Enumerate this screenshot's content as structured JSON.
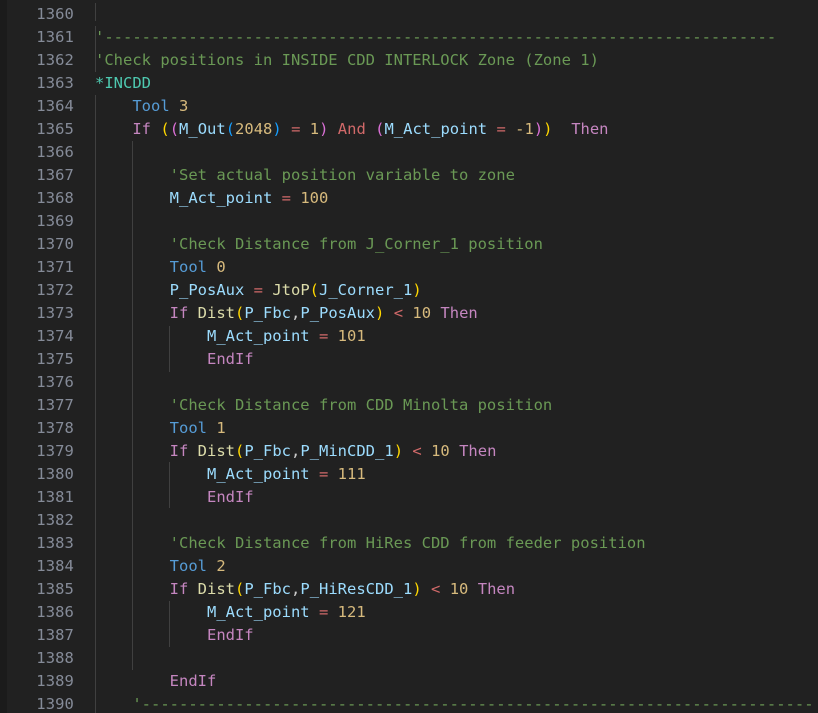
{
  "editor": {
    "theme": "dark-plus",
    "language": "robot-basic",
    "background_color": "#212121",
    "gutter_color": "#1b1b1b",
    "line_number_color": "#858b98",
    "indent_guide_color": "#404040",
    "font_size_px": 15.5,
    "line_height_px": 23,
    "first_line_number": 1360,
    "last_line_number": 1390,
    "total_visible_lines": 31
  },
  "syntax_colors": {
    "comment": "#6A9955",
    "label": "#4EC9B0",
    "keyword": "#C586C0",
    "tool_keyword": "#569CD6",
    "variable": "#9CDCFE",
    "number": "#D7BA7D",
    "operator": "#D16969",
    "function": "#DCDCAA",
    "bracket_level_1": "#FFD700",
    "bracket_level_2": "#DA70D6",
    "bracket_level_3": "#179FFF"
  },
  "lines": [
    {
      "number": "1360",
      "text": ""
    },
    {
      "number": "1361",
      "text": "    '------------------------------------------------------------------------"
    },
    {
      "number": "1362",
      "text": "'Check positions in INSIDE CDD INTERLOCK Zone (Zone 1)"
    },
    {
      "number": "1363",
      "text": "*INCDD"
    },
    {
      "number": "1364",
      "text": "    Tool 3"
    },
    {
      "number": "1365",
      "text": "    If ((M_Out(2048) = 1) And (M_Act_point = -1))  Then"
    },
    {
      "number": "1366",
      "text": ""
    },
    {
      "number": "1367",
      "text": "        'Set actual position variable to zone"
    },
    {
      "number": "1368",
      "text": "        M_Act_point = 100"
    },
    {
      "number": "1369",
      "text": ""
    },
    {
      "number": "1370",
      "text": "        'Check Distance from J_Corner_1 position"
    },
    {
      "number": "1371",
      "text": "        Tool 0"
    },
    {
      "number": "1372",
      "text": "        P_PosAux = JtoP(J_Corner_1)"
    },
    {
      "number": "1373",
      "text": "        If Dist(P_Fbc,P_PosAux) < 10 Then"
    },
    {
      "number": "1374",
      "text": "            M_Act_point = 101"
    },
    {
      "number": "1375",
      "text": "            EndIf"
    },
    {
      "number": "1376",
      "text": ""
    },
    {
      "number": "1377",
      "text": "        'Check Distance from CDD Minolta position"
    },
    {
      "number": "1378",
      "text": "        Tool 1"
    },
    {
      "number": "1379",
      "text": "        If Dist(P_Fbc,P_MinCDD_1) < 10 Then"
    },
    {
      "number": "1380",
      "text": "            M_Act_point = 111"
    },
    {
      "number": "1381",
      "text": "            EndIf"
    },
    {
      "number": "1382",
      "text": ""
    },
    {
      "number": "1383",
      "text": "        'Check Distance from HiRes CDD from feeder position"
    },
    {
      "number": "1384",
      "text": "        Tool 2"
    },
    {
      "number": "1385",
      "text": "        If Dist(P_Fbc,P_HiResCDD_1) < 10 Then"
    },
    {
      "number": "1386",
      "text": "            M_Act_point = 121"
    },
    {
      "number": "1387",
      "text": "            EndIf"
    },
    {
      "number": "1388",
      "text": ""
    },
    {
      "number": "1389",
      "text": "        EndIf"
    },
    {
      "number": "1390",
      "text": "    '------------------------------------------------------------------------"
    }
  ],
  "line_numbers": [
    "1360",
    "1361",
    "1362",
    "1363",
    "1364",
    "1365",
    "1366",
    "1367",
    "1368",
    "1369",
    "1370",
    "1371",
    "1372",
    "1373",
    "1374",
    "1375",
    "1376",
    "1377",
    "1378",
    "1379",
    "1380",
    "1381",
    "1382",
    "1383",
    "1384",
    "1385",
    "1386",
    "1387",
    "1388",
    "1389",
    "1390"
  ],
  "code_tokens": {
    "l1361": {
      "indent": "    ",
      "comment": "'------------------------------------------------------------------------"
    },
    "l1362": {
      "comment": "'Check positions in INSIDE CDD INTERLOCK Zone (Zone 1)"
    },
    "l1363": {
      "label": "*INCDD"
    },
    "l1364": {
      "indent": "    ",
      "kw": "Tool",
      "num": "3"
    },
    "l1365": {
      "indent": "    ",
      "if": "If",
      "b1_open": "(",
      "b2_open": "(",
      "var1": "M_Out",
      "b3_open": "(",
      "num1": "2048",
      "b3_close": ")",
      "eq1": "=",
      "num2": "1",
      "b2_close": ")",
      "and": "And",
      "b2_open2": "(",
      "var2": "M_Act_point",
      "eq2": "=",
      "num3": "-1",
      "b2_close2": ")",
      "b1_close": ")",
      "then": "Then"
    },
    "l1367": {
      "indent": "        ",
      "comment": "'Set actual position variable to zone"
    },
    "l1368": {
      "indent": "        ",
      "var": "M_Act_point",
      "eq": "=",
      "num": "100"
    },
    "l1370": {
      "indent": "        ",
      "comment": "'Check Distance from J_Corner_1 position"
    },
    "l1371": {
      "indent": "        ",
      "kw": "Tool",
      "num": "0"
    },
    "l1372": {
      "indent": "        ",
      "var1": "P_PosAux",
      "eq": "=",
      "fn": "JtoP",
      "open": "(",
      "var2": "J_Corner_1",
      "close": ")"
    },
    "l1373": {
      "indent": "        ",
      "if": "If",
      "fn": "Dist",
      "open": "(",
      "var1": "P_Fbc",
      "comma": ",",
      "var2": "P_PosAux",
      "close": ")",
      "lt": "<",
      "num": "10",
      "then": "Then"
    },
    "l1374": {
      "indent": "            ",
      "var": "M_Act_point",
      "eq": "=",
      "num": "101"
    },
    "l1375": {
      "indent": "            ",
      "kw": "EndIf"
    },
    "l1377": {
      "indent": "        ",
      "comment": "'Check Distance from CDD Minolta position"
    },
    "l1378": {
      "indent": "        ",
      "kw": "Tool",
      "num": "1"
    },
    "l1379": {
      "indent": "        ",
      "if": "If",
      "fn": "Dist",
      "open": "(",
      "var1": "P_Fbc",
      "comma": ",",
      "var2": "P_MinCDD_1",
      "close": ")",
      "lt": "<",
      "num": "10",
      "then": "Then"
    },
    "l1380": {
      "indent": "            ",
      "var": "M_Act_point",
      "eq": "=",
      "num": "111"
    },
    "l1381": {
      "indent": "            ",
      "kw": "EndIf"
    },
    "l1383": {
      "indent": "        ",
      "comment": "'Check Distance from HiRes CDD from feeder position"
    },
    "l1384": {
      "indent": "        ",
      "kw": "Tool",
      "num": "2"
    },
    "l1385": {
      "indent": "        ",
      "if": "If",
      "fn": "Dist",
      "open": "(",
      "var1": "P_Fbc",
      "comma": ",",
      "var2": "P_HiResCDD_1",
      "close": ")",
      "lt": "<",
      "num": "10",
      "then": "Then"
    },
    "l1386": {
      "indent": "            ",
      "var": "M_Act_point",
      "eq": "=",
      "num": "121"
    },
    "l1387": {
      "indent": "            ",
      "kw": "EndIf"
    },
    "l1389": {
      "indent": "        ",
      "kw": "EndIf"
    },
    "l1390": {
      "indent": "    ",
      "comment": "'------------------------------------------------------------------------"
    }
  }
}
